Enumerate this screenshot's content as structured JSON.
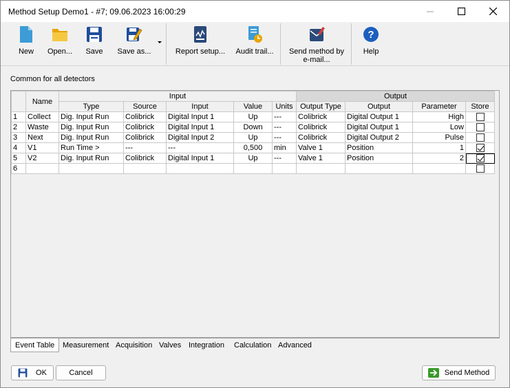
{
  "window": {
    "title": "Method Setup Demo1 - #7;   09.06.2023   16:00:29"
  },
  "toolbar": {
    "items": [
      {
        "label": "New",
        "icon": "new-document-icon"
      },
      {
        "label": "Open...",
        "icon": "folder-icon"
      },
      {
        "label": "Save",
        "icon": "floppy-disk-icon"
      },
      {
        "label": "Save as...",
        "icon": "save-as-icon"
      },
      {
        "label": "Report setup...",
        "icon": "report-icon"
      },
      {
        "label": "Audit trail...",
        "icon": "audit-trail-icon"
      },
      {
        "label": "Send method by",
        "label2": "e-mail...",
        "icon": "email-icon"
      },
      {
        "label": "Help",
        "icon": "help-icon"
      }
    ]
  },
  "caption": "Common for all detectors",
  "grid": {
    "group_headers": {
      "name": "Name",
      "input": "Input",
      "output": "Output"
    },
    "columns": [
      "Type",
      "Source",
      "Input",
      "Value",
      "Units",
      "Output Type",
      "Output",
      "Parameter",
      "Store"
    ],
    "rows": [
      {
        "num": "1",
        "name": "Collect",
        "type": "Dig. Input Run",
        "source": "Colibrick",
        "input": "Digital Input 1",
        "value": "Up",
        "units": "---",
        "output_type": "Colibrick",
        "output": "Digital Output 1",
        "parameter": "High",
        "store": false
      },
      {
        "num": "2",
        "name": "Waste",
        "type": "Dig. Input Run",
        "source": "Colibrick",
        "input": "Digital Input 1",
        "value": "Down",
        "units": "---",
        "output_type": "Colibrick",
        "output": "Digital Output 1",
        "parameter": "Low",
        "store": false
      },
      {
        "num": "3",
        "name": "Next",
        "type": "Dig. Input Run",
        "source": "Colibrick",
        "input": "Digital Input 2",
        "value": "Up",
        "units": "---",
        "output_type": "Colibrick",
        "output": "Digital Output 2",
        "parameter": "Pulse",
        "store": false
      },
      {
        "num": "4",
        "name": "V1",
        "type": "Run Time >",
        "source": "---",
        "input": "---",
        "value": "0,500",
        "units": "min",
        "output_type": "Valve 1",
        "output": "Position",
        "parameter": "1",
        "store": true
      },
      {
        "num": "5",
        "name": "V2",
        "type": "Dig. Input Run",
        "source": "Colibrick",
        "input": "Digital Input 1",
        "value": "Up",
        "units": "---",
        "output_type": "Valve 1",
        "output": "Position",
        "parameter": "2",
        "store": true
      },
      {
        "num": "6",
        "name": "",
        "type": "",
        "source": "",
        "input": "",
        "value": "",
        "units": "",
        "output_type": "",
        "output": "",
        "parameter": "",
        "store": false
      }
    ]
  },
  "tabs": [
    "Event Table",
    "Measurement",
    "Acquisition",
    "Valves",
    "Integration",
    "Calculation",
    "Advanced"
  ],
  "buttons": {
    "ok": "OK",
    "cancel": "Cancel",
    "send_method": "Send Method"
  },
  "colors": {
    "accent_blue": "#1f4e9c",
    "folder_yellow": "#e8a400",
    "help_blue": "#1b5fbf",
    "send_green": "#3a9a2a"
  }
}
